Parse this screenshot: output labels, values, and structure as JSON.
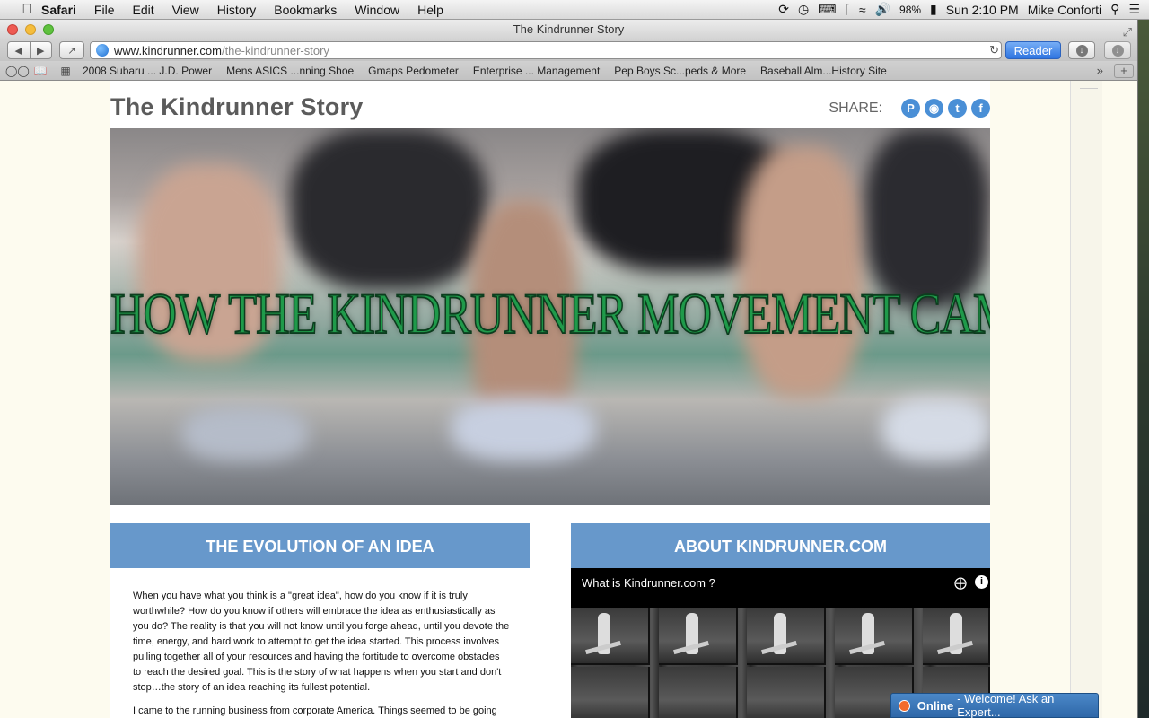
{
  "menubar": {
    "app": "Safari",
    "items": [
      "File",
      "Edit",
      "View",
      "History",
      "Bookmarks",
      "Window",
      "Help"
    ],
    "battery": "98%",
    "clock": "Sun 2:10 PM",
    "user": "Mike Conforti"
  },
  "window": {
    "title": "The Kindrunner Story"
  },
  "toolbar": {
    "url_host": "www.kindrunner.com",
    "url_path": "/the-kindrunner-story",
    "reader_label": "Reader"
  },
  "bookmarks": [
    "2008 Subaru ... J.D. Power",
    "Mens ASICS ...nning Shoe",
    "Gmaps Pedometer",
    "Enterprise ... Management",
    "Pep Boys Sc...peds & More",
    "Baseball Alm...History Site"
  ],
  "page": {
    "title": "The Kindrunner Story",
    "share_label": "SHARE:",
    "hero_headline": "HOW THE KINDRUNNER MOVEMENT CAME TO BE.",
    "evolution_header": "THE EVOLUTION OF AN IDEA",
    "about_header": "ABOUT KINDRUNNER.COM",
    "evolution_paragraph_1": "When you have what you think is a \"great idea\", how do you know if it is truly worthwhile? How do you know if others will embrace the idea as enthusiastically as you do? The reality is that you will not know until you forge ahead, until you devote the time, energy, and hard work to attempt to get the idea started. This process involves pulling together all of your resources and having the fortitude to overcome obstacles to reach the desired goal. This is the story of what happens when you start and don't stop…the story of an idea reaching its fullest potential.",
    "evolution_paragraph_2": "I came to the running business from corporate America. Things seemed to be going",
    "video_title": "What is Kindrunner.com ?"
  },
  "chat": {
    "status": "Online",
    "message": "- Welcome! Ask an Expert..."
  },
  "colors": {
    "section_header": "#6798cb",
    "headline_green": "#1f9a4a",
    "social_blue": "#4a8fd6"
  }
}
